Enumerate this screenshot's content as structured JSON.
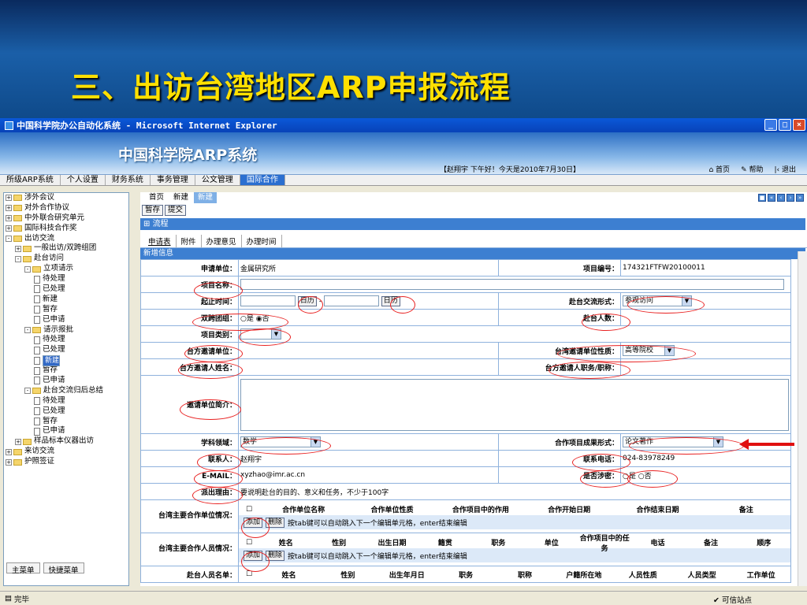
{
  "slide": {
    "title": "三、出访台湾地区ARP申报流程"
  },
  "window": {
    "title": "中国科学院办公自动化系统 - Microsoft Internet Explorer"
  },
  "banner": {
    "logo": "中国科学院ARP系统",
    "greeting": "【赵翔宇 下午好！今天是2010年7月30日】",
    "home": "首页",
    "help": "帮助",
    "logout": "退出"
  },
  "menu": [
    "所级ARP系统",
    "个人设置",
    "财务系统",
    "事务管理",
    "公文管理",
    "国际合作"
  ],
  "tree": [
    {
      "label": "涉外会议",
      "lvl": 0,
      "t": "fold",
      "pm": "+"
    },
    {
      "label": "对外合作协议",
      "lvl": 0,
      "t": "fold",
      "pm": "+"
    },
    {
      "label": "中外联合研究单元",
      "lvl": 0,
      "t": "fold",
      "pm": "+"
    },
    {
      "label": "国际科技合作奖",
      "lvl": 0,
      "t": "fold",
      "pm": "+"
    },
    {
      "label": "出访交流",
      "lvl": 0,
      "t": "fold",
      "pm": "-"
    },
    {
      "label": "一般出访/双跨组团",
      "lvl": 1,
      "t": "fold",
      "pm": "+"
    },
    {
      "label": "赴台访问",
      "lvl": 1,
      "t": "fold",
      "pm": "-"
    },
    {
      "label": "立项请示",
      "lvl": 2,
      "t": "fold",
      "pm": "-"
    },
    {
      "label": "待处理",
      "lvl": 3,
      "t": "doc"
    },
    {
      "label": "已处理",
      "lvl": 3,
      "t": "doc"
    },
    {
      "label": "新建",
      "lvl": 3,
      "t": "doc"
    },
    {
      "label": "暂存",
      "lvl": 3,
      "t": "doc"
    },
    {
      "label": "已申请",
      "lvl": 3,
      "t": "doc"
    },
    {
      "label": "请示报批",
      "lvl": 2,
      "t": "fold",
      "pm": "-"
    },
    {
      "label": "待处理",
      "lvl": 3,
      "t": "doc"
    },
    {
      "label": "已处理",
      "lvl": 3,
      "t": "doc"
    },
    {
      "label": "新建",
      "lvl": 3,
      "t": "doc",
      "sel": true
    },
    {
      "label": "暂存",
      "lvl": 3,
      "t": "doc"
    },
    {
      "label": "已申请",
      "lvl": 3,
      "t": "doc"
    },
    {
      "label": "赴台交流归后总结",
      "lvl": 2,
      "t": "fold",
      "pm": "-"
    },
    {
      "label": "待处理",
      "lvl": 3,
      "t": "doc"
    },
    {
      "label": "已处理",
      "lvl": 3,
      "t": "doc"
    },
    {
      "label": "暂存",
      "lvl": 3,
      "t": "doc"
    },
    {
      "label": "已申请",
      "lvl": 3,
      "t": "doc"
    },
    {
      "label": "样品标本仪器出访",
      "lvl": 1,
      "t": "fold",
      "pm": "+"
    },
    {
      "label": "来访交流",
      "lvl": 0,
      "t": "fold",
      "pm": "+"
    },
    {
      "label": "护照签证",
      "lvl": 0,
      "t": "fold",
      "pm": "+"
    }
  ],
  "tree_foot": [
    "主菜单",
    "快捷菜单"
  ],
  "main": {
    "tabs": [
      "首页",
      "新建",
      "新建"
    ],
    "actions": [
      "暂存",
      "提交"
    ],
    "flow": "流程",
    "subtabs": [
      "申请表",
      "附件",
      "办理意见",
      "办理时间"
    ],
    "section": "新增信息",
    "f": {
      "unit_l": "申请单位：",
      "unit_v": "金属研究所",
      "code_l": "项目编号：",
      "code_v": "174321FTFW20100011",
      "name_l": "项目名称：",
      "time_l": "起止时间：",
      "cal": "日历",
      "form_l": "赴台交流形式：",
      "form_v": "参观访问",
      "dual_l": "双跨团组：",
      "yes": "是",
      "no": "否",
      "count_l": "赴台人数：",
      "type_l": "项目类别：",
      "tw_unit_l": "台方邀请单位：",
      "tw_nature_l": "台湾邀请单位性质：",
      "tw_nature_v": "高等院校",
      "tw_person_l": "台方邀请人姓名：",
      "tw_title_l": "台方邀请人职务/职称：",
      "intro_l": "邀请单位简介：",
      "field_l": "学科领域：",
      "field_v": "数学",
      "result_l": "合作项目成果形式：",
      "result_v": "论文著作",
      "contact_l": "联系人：",
      "contact_v": "赵翔宇",
      "phone_l": "联系电话：",
      "phone_v": "024-83978249",
      "email_l": "E-MAIL：",
      "email_v": "xyzhao@imr.ac.cn",
      "secret_l": "是否涉密：",
      "reason_l": "派出理由：",
      "reason_v": "要说明赴台的目的、意义和任务，不少于100字",
      "cu_l": "台湾主要合作单位情况：",
      "cu_cols": [
        "合作单位名称",
        "合作单位性质",
        "合作项目中的作用",
        "合作开始日期",
        "合作结束日期",
        "备注"
      ],
      "cp_l": "台湾主要合作人员情况：",
      "cp_cols": [
        "姓名",
        "性别",
        "出生日期",
        "籍贯",
        "职务",
        "单位",
        "合作项目中的任务",
        "电话",
        "备注",
        "顺序"
      ],
      "mem_l": "赴台人员名单：",
      "mem_cols": [
        "姓名",
        "性别",
        "出生年月日",
        "职务",
        "职称",
        "户籍所在地",
        "人员性质",
        "人员类型",
        "工作单位"
      ],
      "add": "添加",
      "del": "删除",
      "hint": "按tab键可以自动跳入下一个编辑单元格，enter结束编辑"
    }
  },
  "status": {
    "left": "完毕",
    "right": "可信站点"
  }
}
